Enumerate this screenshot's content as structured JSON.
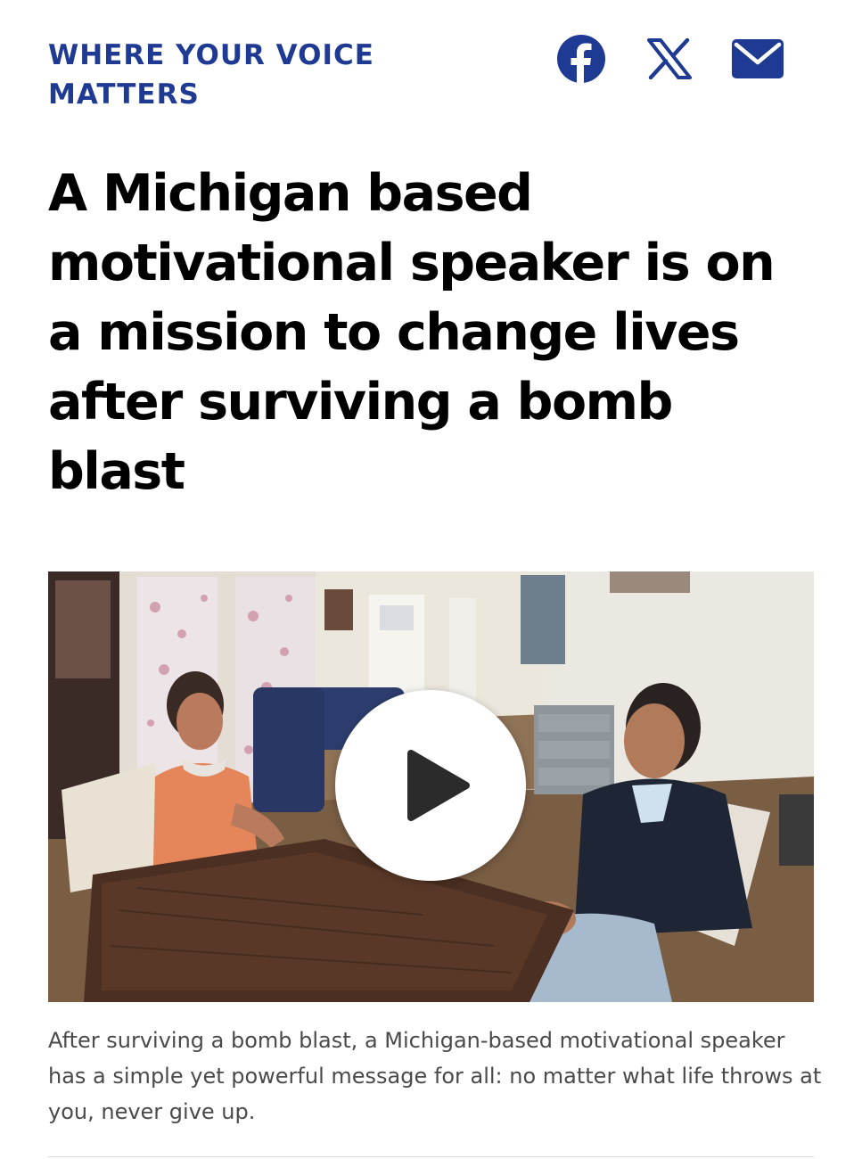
{
  "section": {
    "label": "WHERE YOUR VOICE MATTERS",
    "color": "#1f3a93"
  },
  "share": {
    "facebook_icon": "facebook-icon",
    "x_icon": "x-icon",
    "email_icon": "envelope-icon",
    "icon_color": "#1f3a93"
  },
  "article": {
    "headline": "A Michigan based motivational speaker is on a mission to change lives after surviving a bomb blast",
    "video": {
      "play_icon": "play-icon"
    },
    "caption": "After surviving a bomb blast, a Michigan-based motivational speaker has a simple yet powerful message for all: no matter what life throws at you, never give up."
  }
}
